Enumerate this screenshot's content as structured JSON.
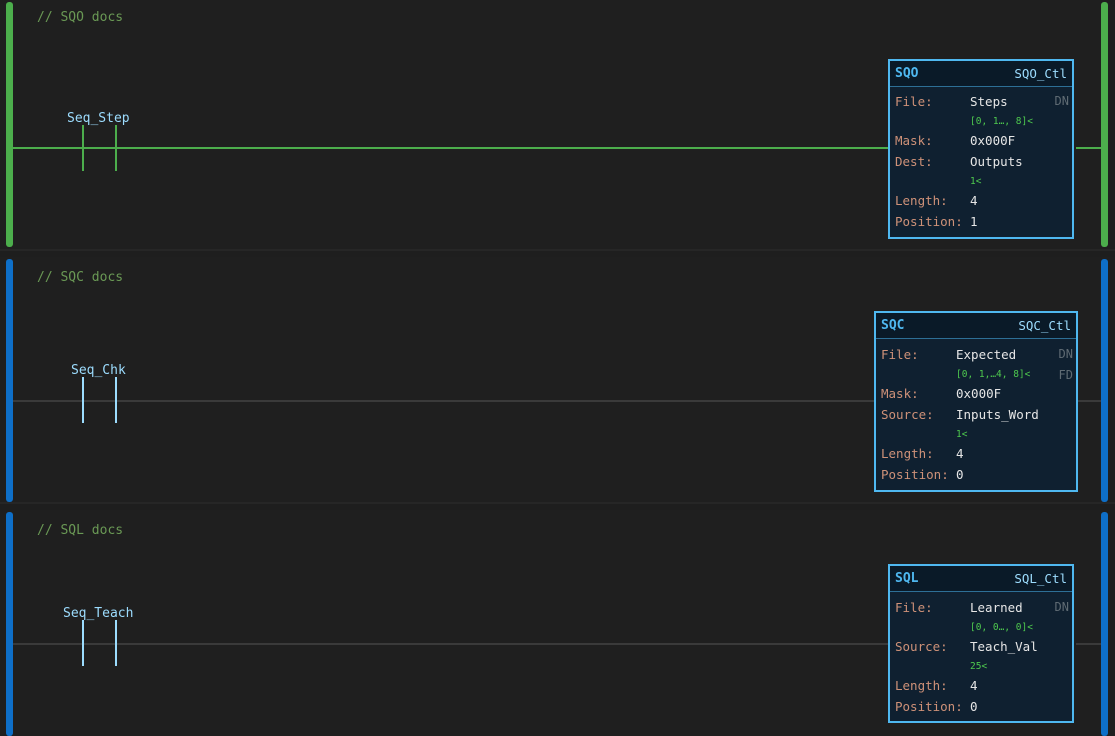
{
  "colors": {
    "energized": "#4cae4c",
    "rail_blue": "#0e6fc8",
    "contact_blue": "#9cdcfe",
    "block_border": "#4fb8f0"
  },
  "rungs": [
    {
      "comment": "// SQO docs",
      "energized": true,
      "contact": {
        "tag": "Seq_Step"
      },
      "block": {
        "name": "SQO",
        "control": "SQO_Ctl",
        "flags": [
          "DN"
        ],
        "rows": [
          {
            "label": "File:",
            "value": "Steps",
            "sub": "[0, 1…, 8]<"
          },
          {
            "label": "Mask:",
            "value": "0x000F",
            "sub": ""
          },
          {
            "label": "Dest:",
            "value": "Outputs",
            "sub": "1<"
          },
          {
            "label": "Length:",
            "value": "4",
            "sub": ""
          },
          {
            "label": "Position:",
            "value": "1",
            "sub": ""
          }
        ]
      }
    },
    {
      "comment": "// SQC docs",
      "energized": false,
      "contact": {
        "tag": "Seq_Chk"
      },
      "block": {
        "name": "SQC",
        "control": "SQC_Ctl",
        "flags": [
          "DN",
          "FD"
        ],
        "rows": [
          {
            "label": "File:",
            "value": "Expected",
            "sub": "[0, 1,…4, 8]<"
          },
          {
            "label": "Mask:",
            "value": "0x000F",
            "sub": ""
          },
          {
            "label": "Source:",
            "value": "Inputs_Word",
            "sub": "1<"
          },
          {
            "label": "Length:",
            "value": "4",
            "sub": ""
          },
          {
            "label": "Position:",
            "value": "0",
            "sub": ""
          }
        ]
      }
    },
    {
      "comment": "// SQL docs",
      "energized": false,
      "contact": {
        "tag": "Seq_Teach"
      },
      "block": {
        "name": "SQL",
        "control": "SQL_Ctl",
        "flags": [
          "DN"
        ],
        "rows": [
          {
            "label": "File:",
            "value": "Learned",
            "sub": "[0, 0…, 0]<"
          },
          {
            "label": "Source:",
            "value": "Teach_Val",
            "sub": "25<"
          },
          {
            "label": "Length:",
            "value": "4",
            "sub": ""
          },
          {
            "label": "Position:",
            "value": "0",
            "sub": ""
          }
        ]
      }
    }
  ]
}
